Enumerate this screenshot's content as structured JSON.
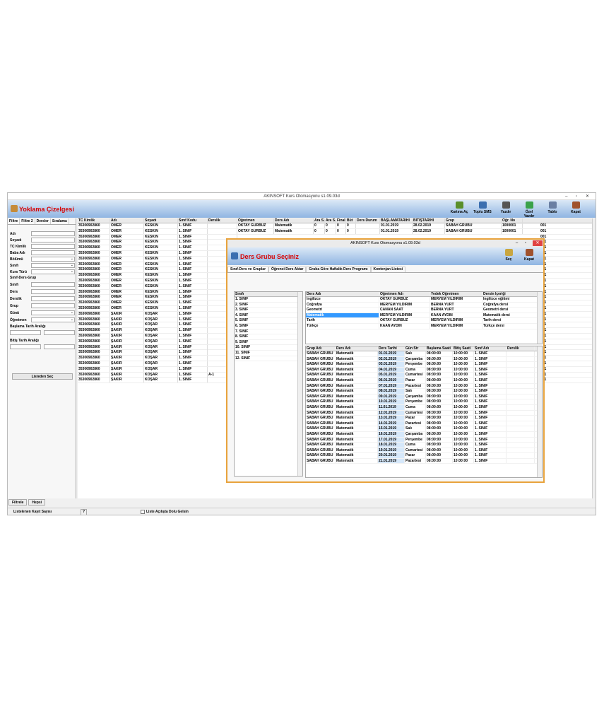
{
  "window": {
    "title": "AKINSOFT Kurs Otomasyonu s1.09.03d",
    "controls": "– ▫ ✕"
  },
  "header": {
    "title": "Yoklama Çizelgesi"
  },
  "toolbar": [
    {
      "label": "Kartına Aç",
      "color": "#5a8f2a"
    },
    {
      "label": "Toplu SMS",
      "color": "#3b6fb0"
    },
    {
      "label": "Yazdır",
      "color": "#555555"
    },
    {
      "label": "Özel Yazdır",
      "color": "#3aa24a"
    },
    {
      "label": "Tablo",
      "color": "#6a7fa3"
    },
    {
      "label": "Kapat",
      "color": "#a0522d"
    }
  ],
  "filter": {
    "tabs": [
      "Filtre",
      "Filtre 2",
      "Dersler",
      "Sıralama"
    ],
    "fields": [
      "Adı",
      "Soyadı",
      "TC Kimlik",
      "Baba Adı",
      "Bölümü",
      "Sınıfı",
      "Kurs Türü"
    ],
    "group_label": "Sınıf-Ders-Grup",
    "fields2": [
      "Sınıfı",
      "Ders",
      "Derslik",
      "Grup",
      "Günü",
      "Öğretmen"
    ],
    "start_label": "Başlama Tarih Aralığı",
    "end_label": "Bitiş Tarih Aralığı",
    "date_placeholder": ". .",
    "list_button": "Listeden Seç"
  },
  "bottom_tabs": [
    "Filtrele",
    "Hepsi"
  ],
  "status": {
    "count_label": "Listelenen Kayıt Sayısı",
    "count": "?",
    "check_label": "Liste Açılışta Dolu Gelsin"
  },
  "grid": {
    "headers": [
      "TC Kimlik",
      "Adı",
      "Soyadı",
      "Sınıf Kodu",
      "Derslik",
      "Öğretmen",
      "Ders Adı",
      "Ara S.1",
      "Ara S.2",
      "Final",
      "Büt",
      "Ders Durum",
      "BAŞLAMATARİHİ",
      "BİTİŞTARİHİ",
      "Grup",
      "Öğr. No"
    ],
    "first_rows": [
      [
        "35306902860",
        "ÖMER",
        "KESKİN",
        "1. SINIF",
        "",
        "OKTAY GÜRBÜZ",
        "Matematik",
        "0",
        "0",
        "0",
        "0",
        "",
        "01.01.2019",
        "28.02.2019",
        "SABAH GRUBU",
        "1000001"
      ],
      [
        "35306902860",
        "ÖMER",
        "KESKİN",
        "1. SINIF",
        "",
        "OKTAY GÜRBÜZ",
        "Matematik",
        "0",
        "0",
        "0",
        "0",
        "",
        "01.01.2019",
        "28.02.2019",
        "SABAH GRUBU",
        "1000001"
      ]
    ],
    "rows": [
      [
        "35306902860",
        "ÖMER",
        "KESKİN",
        "1. SINIF",
        ""
      ],
      [
        "35306902860",
        "ÖMER",
        "KESKİN",
        "1. SINIF",
        ""
      ],
      [
        "35306902860",
        "ÖMER",
        "KESKİN",
        "1. SINIF",
        ""
      ],
      [
        "35306902860",
        "ÖMER",
        "KESKİN",
        "1. SINIF",
        ""
      ],
      [
        "35306902860",
        "ÖMER",
        "KESKİN",
        "1. SINIF",
        ""
      ],
      [
        "35306902860",
        "ÖMER",
        "KESKİN",
        "1. SINIF",
        ""
      ],
      [
        "35306902860",
        "ÖMER",
        "KESKİN",
        "1. SINIF",
        ""
      ],
      [
        "35306902860",
        "ÖMER",
        "KESKİN",
        "1. SINIF",
        ""
      ],
      [
        "35306902860",
        "ÖMER",
        "KESKİN",
        "1. SINIF",
        ""
      ],
      [
        "35306902860",
        "ÖMER",
        "KESKİN",
        "1. SINIF",
        ""
      ],
      [
        "35306902860",
        "ÖMER",
        "KESKİN",
        "1. SINIF",
        ""
      ],
      [
        "35306902860",
        "ÖMER",
        "KESKİN",
        "1. SINIF",
        ""
      ],
      [
        "35306902860",
        "ÖMER",
        "KESKİN",
        "1. SINIF",
        ""
      ],
      [
        "35306902860",
        "ÖMER",
        "KESKİN",
        "1. SINIF",
        ""
      ],
      [
        "35306902860",
        "ŞAKİR",
        "KOŞAR",
        "1. SINIF",
        ""
      ],
      [
        "35306902860",
        "ŞAKİR",
        "KOŞAR",
        "1. SINIF",
        ""
      ],
      [
        "35306902860",
        "ŞAKİR",
        "KOŞAR",
        "1. SINIF",
        ""
      ],
      [
        "35306902860",
        "ŞAKİR",
        "KOŞAR",
        "1. SINIF",
        ""
      ],
      [
        "35306902860",
        "ŞAKİR",
        "KOŞAR",
        "1. SINIF",
        ""
      ],
      [
        "35306902860",
        "ŞAKİR",
        "KOŞAR",
        "1. SINIF",
        ""
      ],
      [
        "35306902860",
        "ŞAKİR",
        "KOŞAR",
        "1. SINIF",
        ""
      ],
      [
        "35306902860",
        "ŞAKİR",
        "KOŞAR",
        "1. SINIF",
        ""
      ],
      [
        "35306902860",
        "ŞAKİR",
        "KOŞAR",
        "1. SINIF",
        ""
      ],
      [
        "35306902860",
        "ŞAKİR",
        "KOŞAR",
        "1. SINIF",
        ""
      ],
      [
        "35306902860",
        "ŞAKİR",
        "KOŞAR",
        "1. SINIF",
        ""
      ],
      [
        "35306902860",
        "ŞAKİR",
        "KOŞAR",
        "1. SINIF",
        "A-1"
      ],
      [
        "35306902860",
        "ŞAKİR",
        "KOŞAR",
        "1. SINIF",
        ""
      ]
    ],
    "right_col": [
      "001",
      "001",
      "001",
      "001",
      "001",
      "001",
      "001",
      "001",
      "001",
      "001",
      "001",
      "001",
      "001",
      "001",
      "001",
      "001",
      "001",
      "001",
      "001",
      "001",
      "001",
      "001",
      "001",
      "001",
      "001",
      "001",
      "001",
      "001",
      "001"
    ]
  },
  "dialog": {
    "title": "AKINSOFT Kurs Otomasyonu s1.09.03d",
    "heading": "Ders Grubu Seçiniz",
    "buttons": [
      "Seç",
      "Kapat"
    ],
    "tabs": [
      "Sınıf-Ders ve Gruplar",
      "Öğrenci Ders Aktar",
      "Gruba Göre Haftalık Ders Programı",
      "Kontenjan Listesi"
    ],
    "class_header": "Sınıfı",
    "classes": [
      "1. SINIF",
      "2. SINIF",
      "3. SINIF",
      "4. SINIF",
      "5. SINIF",
      "6. SINIF",
      "7. SINIF",
      "8. SINIF",
      "9. SINIF",
      "10. SINIF",
      "11. SINIF",
      "12. SINIF"
    ],
    "course_headers": [
      "Ders Adı",
      "Öğretmen Adı",
      "Yedek Öğretmen",
      "Dersin İçeriği"
    ],
    "courses": [
      [
        "İngilizce",
        "OKTAY GÜRBÜZ",
        "MERYEM YILDIRIM",
        "İngilizce eğitimi"
      ],
      [
        "Coğrafya",
        "MERYEM YILDIRIM",
        "BERNA YURT",
        "Coğrafya dersi"
      ],
      [
        "Geometri",
        "CANAN SAAT",
        "BERNA YURT",
        "Geometri dersi"
      ],
      [
        "Matematik",
        "MERYEM YILDIRIM",
        "KAAN AYDIN",
        "Matematik dersi"
      ],
      [
        "Tarih",
        "OKTAY GÜRBÜZ",
        "MERYEM YILDIRIM",
        "Tarih dersi"
      ],
      [
        "Türkçe",
        "KAAN AYDIN",
        "MERYEM YILDIRIM",
        "Türkçe dersi"
      ]
    ],
    "session_headers": [
      "Grup Adı",
      "Ders Adı",
      "Ders Tarihi",
      "Gün Str",
      "Başlama Saati",
      "Bitiş Saati",
      "Sınıf Adı",
      "Derslik"
    ],
    "sessions": [
      [
        "SABAH GRUBU",
        "Matematik",
        "01.01.2019",
        "Salı",
        "08:00:00",
        "10:00:00",
        "1. SINIF",
        ""
      ],
      [
        "SABAH GRUBU",
        "Matematik",
        "02.01.2019",
        "Çarşamba",
        "08:00:00",
        "10:00:00",
        "1. SINIF",
        ""
      ],
      [
        "SABAH GRUBU",
        "Matematik",
        "03.01.2019",
        "Perşembe",
        "08:00:00",
        "10:00:00",
        "1. SINIF",
        ""
      ],
      [
        "SABAH GRUBU",
        "Matematik",
        "04.01.2019",
        "Cuma",
        "08:00:00",
        "10:00:00",
        "1. SINIF",
        ""
      ],
      [
        "SABAH GRUBU",
        "Matematik",
        "05.01.2019",
        "Cumartesi",
        "08:00:00",
        "10:00:00",
        "1. SINIF",
        ""
      ],
      [
        "SABAH GRUBU",
        "Matematik",
        "06.01.2019",
        "Pazar",
        "08:00:00",
        "10:00:00",
        "1. SINIF",
        ""
      ],
      [
        "SABAH GRUBU",
        "Matematik",
        "07.01.2019",
        "Pazartesi",
        "08:00:00",
        "10:00:00",
        "1. SINIF",
        ""
      ],
      [
        "SABAH GRUBU",
        "Matematik",
        "08.01.2019",
        "Salı",
        "08:00:00",
        "10:00:00",
        "1. SINIF",
        ""
      ],
      [
        "SABAH GRUBU",
        "Matematik",
        "09.01.2019",
        "Çarşamba",
        "08:00:00",
        "10:00:00",
        "1. SINIF",
        ""
      ],
      [
        "SABAH GRUBU",
        "Matematik",
        "10.01.2019",
        "Perşembe",
        "08:00:00",
        "10:00:00",
        "1. SINIF",
        ""
      ],
      [
        "SABAH GRUBU",
        "Matematik",
        "11.01.2019",
        "Cuma",
        "08:00:00",
        "10:00:00",
        "1. SINIF",
        ""
      ],
      [
        "SABAH GRUBU",
        "Matematik",
        "12.01.2019",
        "Cumartesi",
        "08:00:00",
        "10:00:00",
        "1. SINIF",
        ""
      ],
      [
        "SABAH GRUBU",
        "Matematik",
        "13.01.2019",
        "Pazar",
        "08:00:00",
        "10:00:00",
        "1. SINIF",
        ""
      ],
      [
        "SABAH GRUBU",
        "Matematik",
        "14.01.2019",
        "Pazartesi",
        "08:00:00",
        "10:00:00",
        "1. SINIF",
        ""
      ],
      [
        "SABAH GRUBU",
        "Matematik",
        "15.01.2019",
        "Salı",
        "08:00:00",
        "10:00:00",
        "1. SINIF",
        ""
      ],
      [
        "SABAH GRUBU",
        "Matematik",
        "16.01.2019",
        "Çarşamba",
        "08:00:00",
        "10:00:00",
        "1. SINIF",
        ""
      ],
      [
        "SABAH GRUBU",
        "Matematik",
        "17.01.2019",
        "Perşembe",
        "08:00:00",
        "10:00:00",
        "1. SINIF",
        ""
      ],
      [
        "SABAH GRUBU",
        "Matematik",
        "18.01.2019",
        "Cuma",
        "08:00:00",
        "10:00:00",
        "1. SINIF",
        ""
      ],
      [
        "SABAH GRUBU",
        "Matematik",
        "19.01.2019",
        "Cumartesi",
        "08:00:00",
        "10:00:00",
        "1. SINIF",
        ""
      ],
      [
        "SABAH GRUBU",
        "Matematik",
        "20.01.2019",
        "Pazar",
        "08:00:00",
        "10:00:00",
        "1. SINIF",
        ""
      ],
      [
        "SABAH GRUBU",
        "Matematik",
        "21.01.2019",
        "Pazartesi",
        "08:00:00",
        "10:00:00",
        "1. SINIF",
        ""
      ]
    ]
  }
}
